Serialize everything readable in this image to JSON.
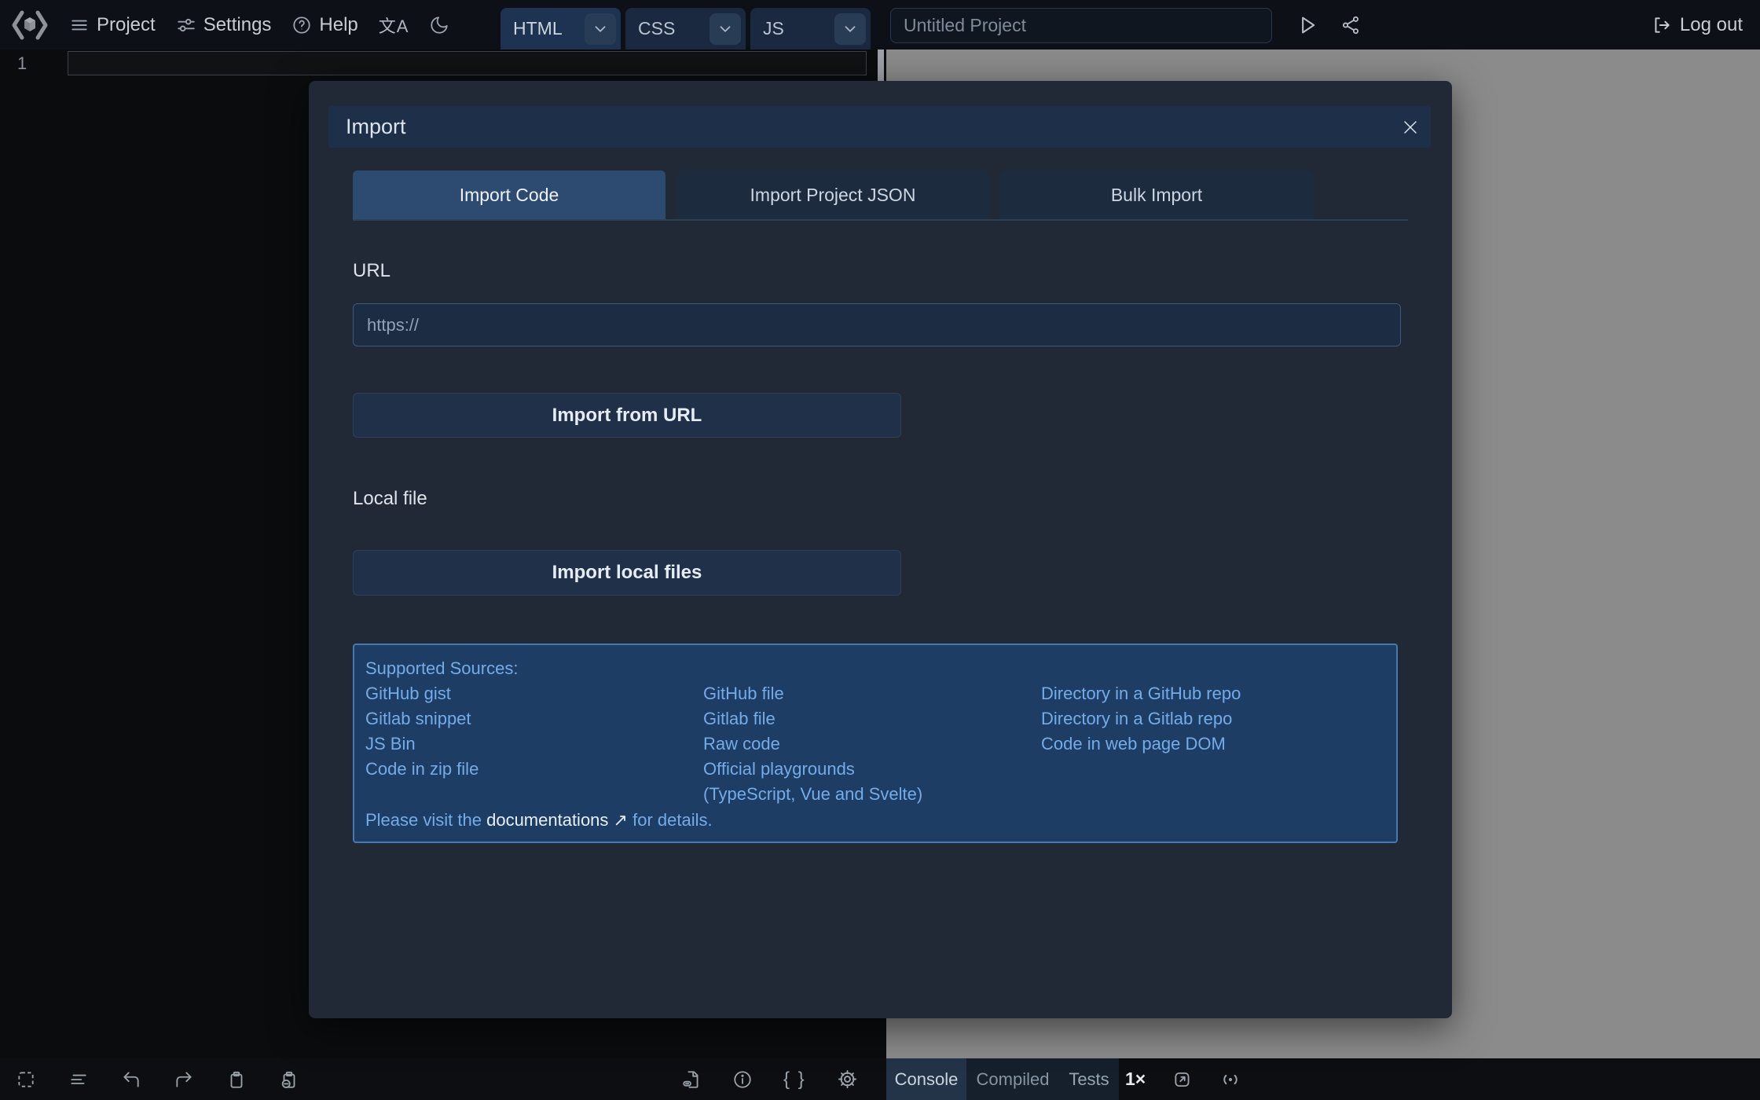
{
  "topbar": {
    "project_label": "Project",
    "settings_label": "Settings",
    "help_label": "Help",
    "editors": [
      "HTML",
      "CSS",
      "JS"
    ],
    "project_title_placeholder": "Untitled Project",
    "logout_label": "Log out"
  },
  "editor": {
    "line_number": "1"
  },
  "modal": {
    "title": "Import",
    "tabs": [
      "Import Code",
      "Import Project JSON",
      "Bulk Import"
    ],
    "url_label": "URL",
    "url_placeholder": "https://",
    "import_from_url": "Import from URL",
    "local_file_label": "Local file",
    "import_local_files": "Import local files",
    "sources": {
      "heading": "Supported Sources:",
      "columns": [
        [
          "GitHub gist",
          "Gitlab snippet",
          "JS Bin",
          "Code in zip file"
        ],
        [
          "GitHub file",
          "Gitlab file",
          "Raw code",
          "Official playgrounds",
          "(TypeScript, Vue and Svelte)"
        ],
        [
          "Directory in a GitHub repo",
          "Directory in a Gitlab repo",
          "Code in web page DOM"
        ]
      ],
      "footer": {
        "prefix": "Please visit the",
        "link": "documentations",
        "arrow": "↗",
        "suffix": "for details."
      }
    }
  },
  "statusbar": {
    "tools": [
      "Console",
      "Compiled",
      "Tests"
    ],
    "zoom": "1×"
  },
  "icons": {
    "translate": "文A",
    "braces": "{ }",
    "close": "✕"
  },
  "colors": {
    "topbar_bg": "#0d1016",
    "modal_bg": "#212936",
    "modal_header_bg": "#1e3049",
    "active_tab": "#2d4a70",
    "sources_bg": "#1d3d64",
    "sources_border": "#4579af",
    "link_blue": "#74ace9",
    "result_gray": "#8b8b8b",
    "button_bg": "#203049"
  }
}
